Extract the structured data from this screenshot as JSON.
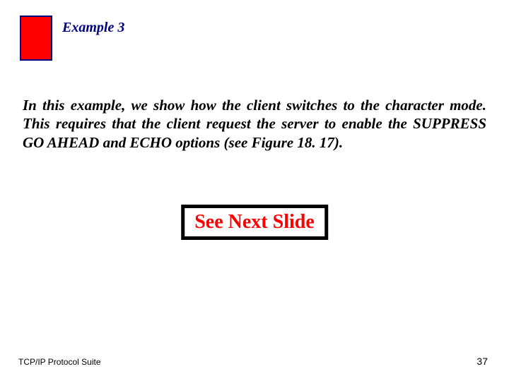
{
  "header": {
    "title": "Example 3"
  },
  "body": {
    "paragraph": "In this example, we show how the client switches to the character mode. This requires that the client request the server to enable the SUPPRESS GO AHEAD and ECHO options (see Figure 18. 17)."
  },
  "cta": {
    "label": "See Next Slide"
  },
  "footer": {
    "left": "TCP/IP Protocol Suite",
    "right": "37"
  }
}
